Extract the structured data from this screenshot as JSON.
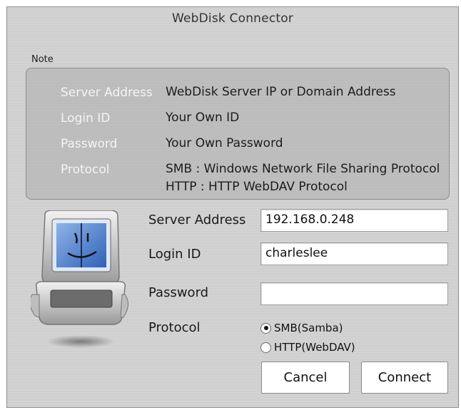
{
  "window": {
    "title": "WebDisk Connector"
  },
  "note": {
    "label": "Note",
    "rows": [
      {
        "key": "Server Address",
        "value_lines": [
          "WebDisk Server IP or Domain Address"
        ]
      },
      {
        "key": "Login ID",
        "value_lines": [
          "Your Own ID"
        ]
      },
      {
        "key": "Password",
        "value_lines": [
          "Your Own Password"
        ]
      },
      {
        "key": "Protocol",
        "value_lines": [
          "SMB : Windows Network File Sharing Protocol",
          "HTTP : HTTP WebDAV Protocol"
        ]
      }
    ]
  },
  "form": {
    "server_address": {
      "label": "Server Address",
      "value": "192.168.0.248"
    },
    "login_id": {
      "label": "Login ID",
      "value": "charleslee"
    },
    "password": {
      "label": "Password",
      "value": ""
    },
    "protocol": {
      "label": "Protocol",
      "options": [
        {
          "label": "SMB(Samba)",
          "selected": true
        },
        {
          "label": "HTTP(WebDAV)",
          "selected": false
        }
      ]
    }
  },
  "buttons": {
    "cancel": "Cancel",
    "connect": "Connect"
  },
  "icons": {
    "app_icon": "laptop-finder-icon"
  }
}
